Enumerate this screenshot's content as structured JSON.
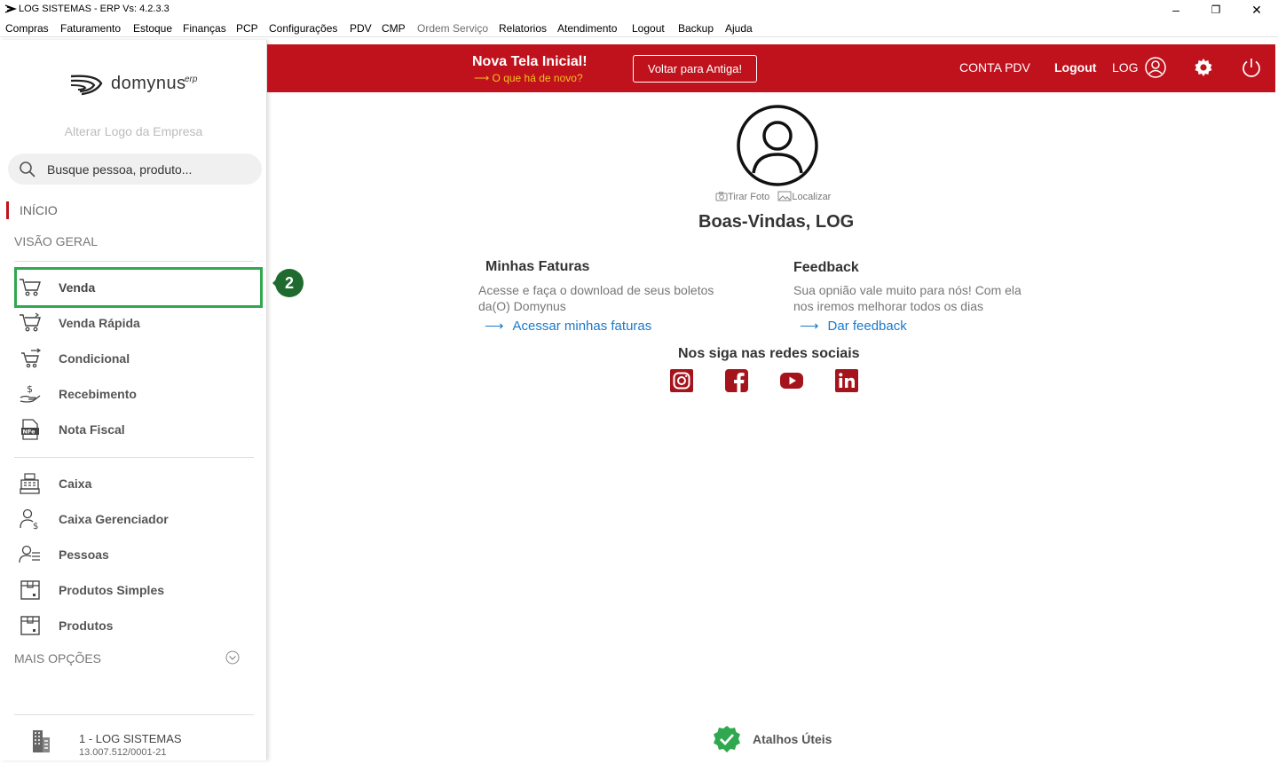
{
  "window": {
    "title": "LOG SISTEMAS - ERP Vs: 4.2.3.3",
    "controls": [
      "–",
      "❐",
      "✕"
    ]
  },
  "menu": [
    {
      "label": "Compras"
    },
    {
      "label": "Faturamento"
    },
    {
      "label": "Estoque"
    },
    {
      "label": "Finanças"
    },
    {
      "label": "PCP"
    },
    {
      "label": "Configurações"
    },
    {
      "label": "PDV"
    },
    {
      "label": "CMP"
    },
    {
      "label": "Ordem Serviço",
      "disabled": true
    },
    {
      "label": "Relatorios"
    },
    {
      "label": "Atendimento"
    },
    {
      "label": "Logout"
    },
    {
      "label": "Backup"
    },
    {
      "label": "Ajuda"
    }
  ],
  "sidebar": {
    "logo_text": "domynus",
    "logo_sup": "erp",
    "alter_logo": "Alterar Logo da Empresa",
    "search_placeholder": "Busque pessoa, produto...",
    "inicio": "INÍCIO",
    "visao_geral": "VISÃO GERAL",
    "items_group1": [
      {
        "label": "Venda",
        "icon": "cart-icon"
      },
      {
        "label": "Venda Rápida",
        "icon": "cart-fast-icon"
      },
      {
        "label": "Condicional",
        "icon": "cart-return-icon"
      },
      {
        "label": "Recebimento",
        "icon": "money-hand-icon"
      },
      {
        "label": "Nota Fiscal",
        "icon": "nfe-icon"
      }
    ],
    "items_group2": [
      {
        "label": "Caixa",
        "icon": "cash-register-icon"
      },
      {
        "label": "Caixa Gerenciador",
        "icon": "user-money-icon"
      },
      {
        "label": "Pessoas",
        "icon": "user-list-icon"
      },
      {
        "label": "Produtos Simples",
        "icon": "box-icon"
      },
      {
        "label": "Produtos",
        "icon": "box-icon"
      }
    ],
    "mais_opcoes": "MAIS OPÇÕES",
    "company_name": "1 - LOG SISTEMAS",
    "company_cnpj": "13.007.512/0001-21",
    "step_badge": "2"
  },
  "topbar": {
    "nova_tela": "Nova Tela Inicial!",
    "novo_link": "⟶ O que há de novo?",
    "voltar": "Voltar para Antiga!",
    "conta_pdv": "CONTA PDV",
    "logout": "Logout",
    "user": "LOG",
    "bg_color": "#c0121c"
  },
  "main": {
    "tirar_foto": "Tirar Foto",
    "localizar": "Localizar",
    "welcome": "Boas-Vindas, LOG",
    "faturas_title": "Minhas Faturas",
    "faturas_text": "Acesse e faça o download de seus boletos da(O) Domynus",
    "faturas_link": "Acessar minhas faturas",
    "feedback_title": "Feedback",
    "feedback_text": "Sua opnião vale muito para nós! Com ela nos iremos melhorar todos os dias",
    "feedback_link": "Dar feedback",
    "social_title": "Nos siga nas redes sociais",
    "social": [
      "instagram-icon",
      "facebook-icon",
      "youtube-icon",
      "linkedin-icon"
    ],
    "atalhos": "Atalhos Úteis"
  }
}
